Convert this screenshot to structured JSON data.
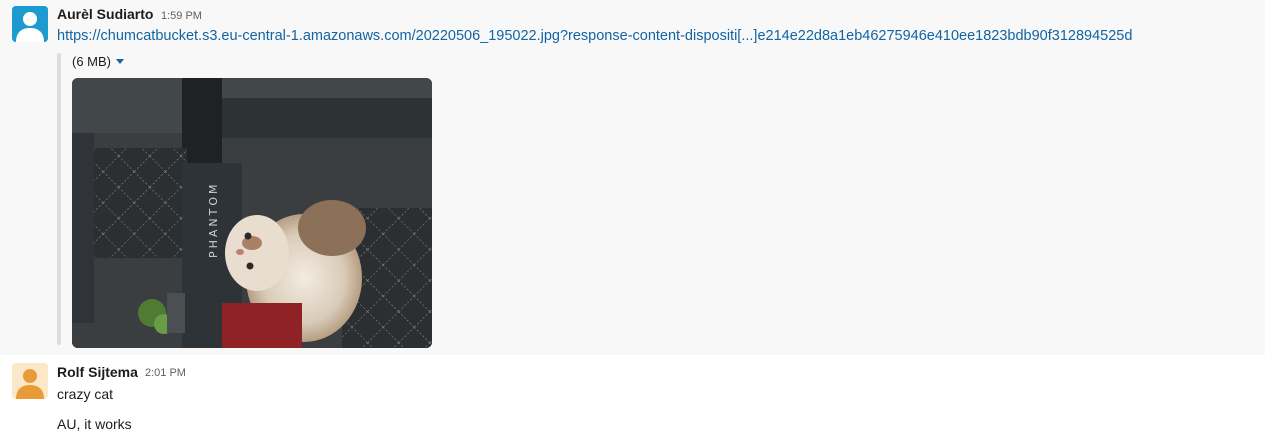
{
  "messages": [
    {
      "author": "Aurèl Sudiarto",
      "time": "1:59 PM",
      "link": "https://chumcatbucket.s3.eu-central-1.amazonaws.com/20220506_195022.jpg?response-content-dispositi[...]e214e22d8a1eb46275946e410ee1823bdb90f312894525d",
      "attachment": {
        "size_label": "(6 MB)",
        "image_text": "PHANTOM"
      }
    },
    {
      "author": "Rolf Sijtema",
      "time": "2:01 PM",
      "lines": [
        "crazy cat",
        "AU, it works"
      ]
    }
  ],
  "colors": {
    "link": "#1264a3",
    "avatar1": "#1d9bd1",
    "avatar2": "#e99b3a"
  }
}
